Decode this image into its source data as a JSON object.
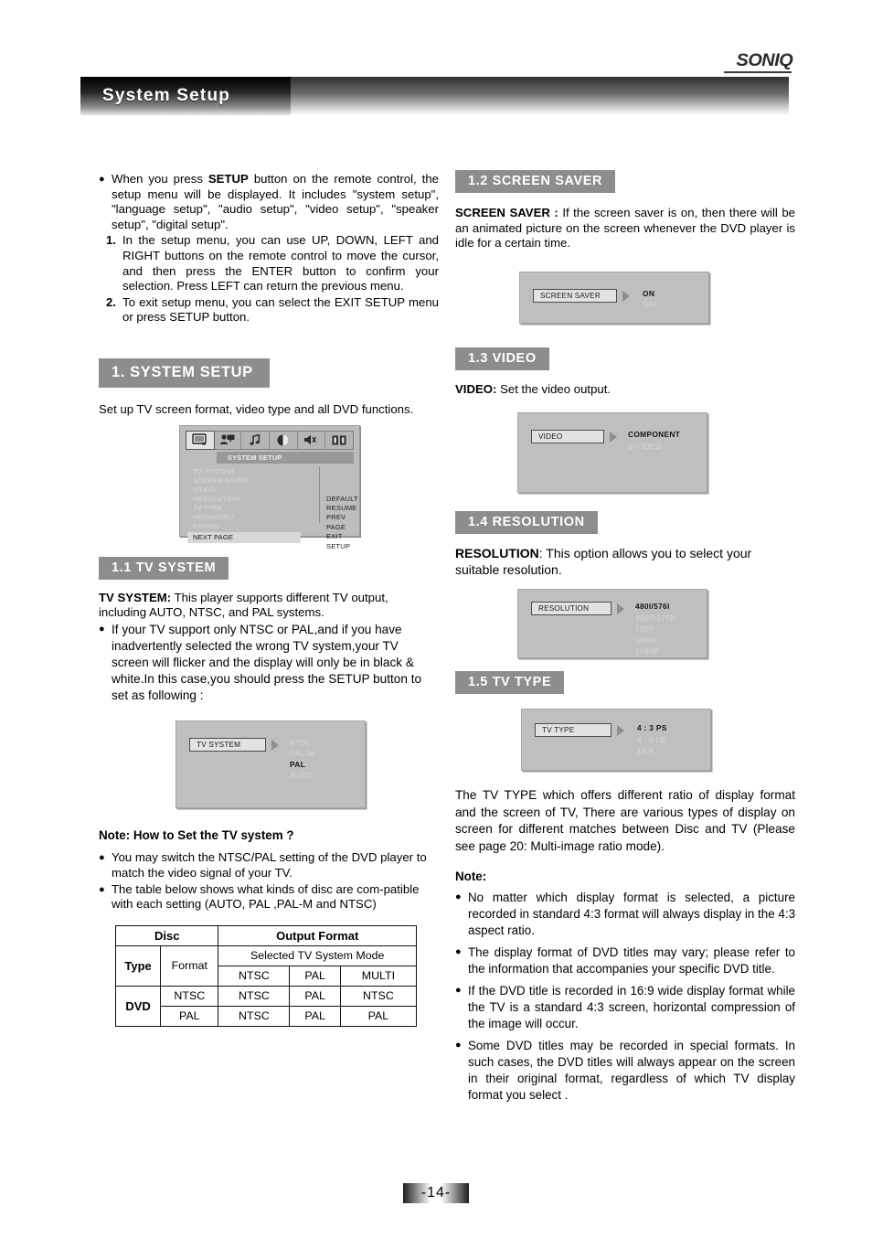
{
  "brand": {
    "logo_text": "SONIQ"
  },
  "header": {
    "title": "System Setup"
  },
  "footer": {
    "page_number": "-14-"
  },
  "left_column": {
    "intro_bullet": "When you press SETUP button on the remote control, the setup menu will be displayed. It includes \"system setup\", \"language setup\", \"audio setup\", \"video setup\", \"speaker setup\", \"digital setup\".",
    "intro_bullet_bold_word": "SETUP",
    "step1_number": "1",
    "step1_text": "In the setup menu, you can use UP, DOWN, LEFT and RIGHT buttons on the remote control to move the cursor, and then press the ENTER button to confirm your selection. Press LEFT can return the previous menu.",
    "step2_number": "2",
    "step2_text": "To exit setup menu, you can select the EXIT SETUP menu or press SETUP button.",
    "section1_heading": "1. SYSTEM SETUP",
    "section1_desc": "Set up TV screen format, video type and all DVD functions.",
    "osd_main": {
      "subtitle": "SYSTEM SETUP",
      "icons": [
        {
          "name": "tv-monitor-icon",
          "selected": true
        },
        {
          "name": "language-person-icon",
          "selected": false
        },
        {
          "name": "audio-note-icon",
          "selected": false
        },
        {
          "name": "video-circle-icon",
          "selected": false
        },
        {
          "name": "speaker-icon",
          "selected": false
        },
        {
          "name": "digital-bars-icon",
          "selected": false
        }
      ],
      "menu_items": [
        {
          "label": "TV SYSTEM",
          "highlighted": false
        },
        {
          "label": "SCREEN SAVER",
          "highlighted": false
        },
        {
          "label": "VIDEO",
          "highlighted": false
        },
        {
          "label": "RESOLUTION",
          "highlighted": false
        },
        {
          "label": "TV TYPE",
          "highlighted": false
        },
        {
          "label": "PASSWORD",
          "highlighted": false
        },
        {
          "label": "RATING",
          "highlighted": false
        },
        {
          "label": "NEXT PAGE",
          "highlighted": true
        }
      ],
      "right_items": [
        "DEFAULT",
        "RESUME",
        "PREV PAGE",
        "EXIT SETUP"
      ]
    },
    "section11_heading": "1.1  TV SYSTEM",
    "tv_system_label": "TV SYSTEM:",
    "tv_system_desc": " This player supports different TV output, including AUTO,  NTSC,  and PAL systems.",
    "tv_system_bullet": "If your TV support only NTSC or PAL,and if you have inadvertently selected the wrong TV system,your TV screen will flicker and the display will only be in black & white.In this case,you should press the SETUP button to set as following :",
    "osd_tv_system": {
      "label": "TV SYSTEM",
      "options": [
        {
          "label": "NTSC",
          "selected": false
        },
        {
          "label": "PAL-M",
          "selected": false
        },
        {
          "label": "PAL",
          "selected": true
        },
        {
          "label": "AUTO",
          "selected": false
        }
      ]
    },
    "note_heading": "Note: How to Set the TV system ?",
    "note_bullets": [
      "You may switch the NTSC/PAL setting of the DVD player to match the  video  signal of  your TV.",
      "The table below shows what kinds of disc are com-patible with each setting (AUTO, PAL ,PAL-M and NTSC)"
    ],
    "table": {
      "col_disc": "Disc",
      "col_output": "Output Format",
      "row_type": "Type",
      "row_format": "Format",
      "selected_mode": "Selected TV System Mode",
      "modes": [
        "NTSC",
        "PAL",
        "MULTI"
      ],
      "rows": [
        {
          "type": "DVD",
          "format": "NTSC",
          "values": [
            "NTSC",
            "PAL",
            "NTSC"
          ]
        },
        {
          "type": "",
          "format": "PAL",
          "values": [
            "NTSC",
            "PAL",
            "PAL"
          ]
        }
      ]
    }
  },
  "right_column": {
    "section12_heading": "1.2  SCREEN SAVER",
    "screen_saver_label": "SCREEN SAVER :",
    "screen_saver_desc": " If the screen saver is on, then there will be an animated picture on the screen whenever the DVD player is idle for a certain time.",
    "osd_screen_saver": {
      "label": "SCREEN SAVER",
      "options": [
        {
          "label": "ON",
          "selected": true
        },
        {
          "label": "OFF",
          "selected": false
        }
      ]
    },
    "section13_heading": "1.3  VIDEO",
    "video_label": "VIDEO:",
    "video_desc": " Set   the video output.",
    "osd_video": {
      "label": "VIDEO",
      "options": [
        {
          "label": "COMPONENT",
          "selected": true
        },
        {
          "label": "S-VIDEO",
          "selected": false
        }
      ]
    },
    "section14_heading": "1.4 RESOLUTION",
    "resolution_label": "RESOLUTION",
    "resolution_desc": ": This option allows you to select your suitable resolution.",
    "osd_resolution": {
      "label": "RESOLUTION",
      "options": [
        {
          "label": "480I/576I",
          "selected": true
        },
        {
          "label": "480P/576P",
          "selected": false
        },
        {
          "label": "720P",
          "selected": false
        },
        {
          "label": "1080I",
          "selected": false
        },
        {
          "label": "1080P",
          "selected": false
        }
      ]
    },
    "section15_heading": "1.5  TV TYPE",
    "osd_tv_type": {
      "label": "TV TYPE",
      "options": [
        {
          "label": "4 : 3 PS",
          "selected": true
        },
        {
          "label": "4 : 3 LB",
          "selected": false
        },
        {
          "label": "16:9",
          "selected": false
        }
      ]
    },
    "tv_type_desc": "The TV  TYPE  which  offers different ratio of display format and the screen of TV,  There are various types of  display  on  screen  for  different matches between Disc and TV (Please see page 20: Multi-image ratio mode).",
    "note_heading": "Note:",
    "note_bullets": [
      "No matter which display format is selected, a picture recorded in standard 4:3 format will always display in the 4:3 aspect ratio.",
      "The display format of DVD titles may vary; please refer to the information that accompanies your specific DVD title.",
      "If the DVD  title is recorded  in 16:9  wide  display format while the TV is a standard 4:3 screen, horizontal compression of the image will occur.",
      "Some DVD titles may be recorded in special formats. In such cases, the DVD titles will always appear on the screen in their original format, regardless of which TV display format you select ."
    ]
  },
  "colors": {
    "section_bar": "#8d8d8d",
    "osd_background": "#bfbfbf",
    "osd_selected_text": "#161616",
    "osd_dim_text": "#d6d6d6"
  }
}
